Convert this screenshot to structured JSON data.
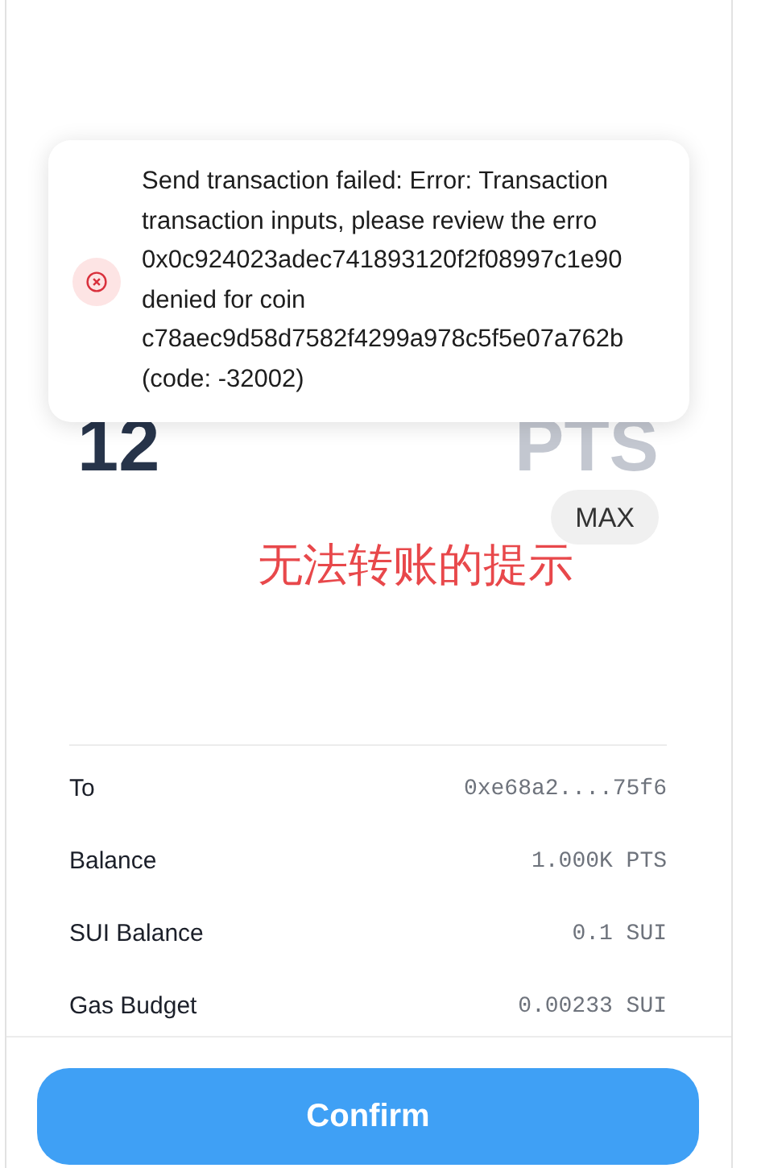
{
  "toast": {
    "kind": "error",
    "lines": [
      "Send transaction failed: Error: Transaction",
      "transaction inputs, please review the erro",
      "0x0c924023adec741893120f2f08997c1e90",
      "denied for coin",
      "c78aec9d58d7582f4299a978c5f5e07a762b",
      "(code: -32002)"
    ]
  },
  "amount": {
    "value": "12",
    "unit": "PTS"
  },
  "max_button": "MAX",
  "annotation": "无法转账的提示",
  "details": [
    {
      "label": "To",
      "value": "0xe68a2....75f6"
    },
    {
      "label": "Balance",
      "value": "1.000K PTS"
    },
    {
      "label": "SUI Balance",
      "value": "0.1 SUI"
    },
    {
      "label": "Gas Budget",
      "value": "0.00233 SUI"
    }
  ],
  "confirm_button": "Confirm"
}
